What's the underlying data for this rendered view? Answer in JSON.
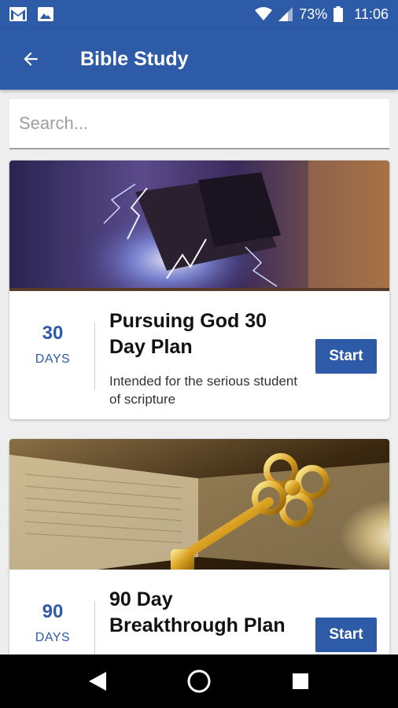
{
  "status_bar": {
    "battery": "73%",
    "time": "11:06",
    "icons": [
      "gmail-icon",
      "photos-icon",
      "wifi-icon",
      "signal-icon",
      "battery-icon"
    ]
  },
  "app_bar": {
    "title": "Bible Study",
    "back_icon": "arrow-back-icon",
    "color": "#2d5ba8"
  },
  "search": {
    "placeholder": "Search..."
  },
  "plans": [
    {
      "days": "30",
      "unit": "DAYS",
      "title": "Pursuing God 30 Day Plan",
      "description": "Intended for the serious student of scripture",
      "button": "Start",
      "image": "holy-bible-lightning-image"
    },
    {
      "days": "90",
      "unit": "DAYS",
      "title": "90 Day Breakthrough Plan",
      "description": "",
      "button": "Start",
      "image": "golden-key-open-bible-image"
    }
  ],
  "nav_bar": {
    "icons": [
      "back-triangle-icon",
      "home-circle-icon",
      "recents-square-icon"
    ]
  }
}
